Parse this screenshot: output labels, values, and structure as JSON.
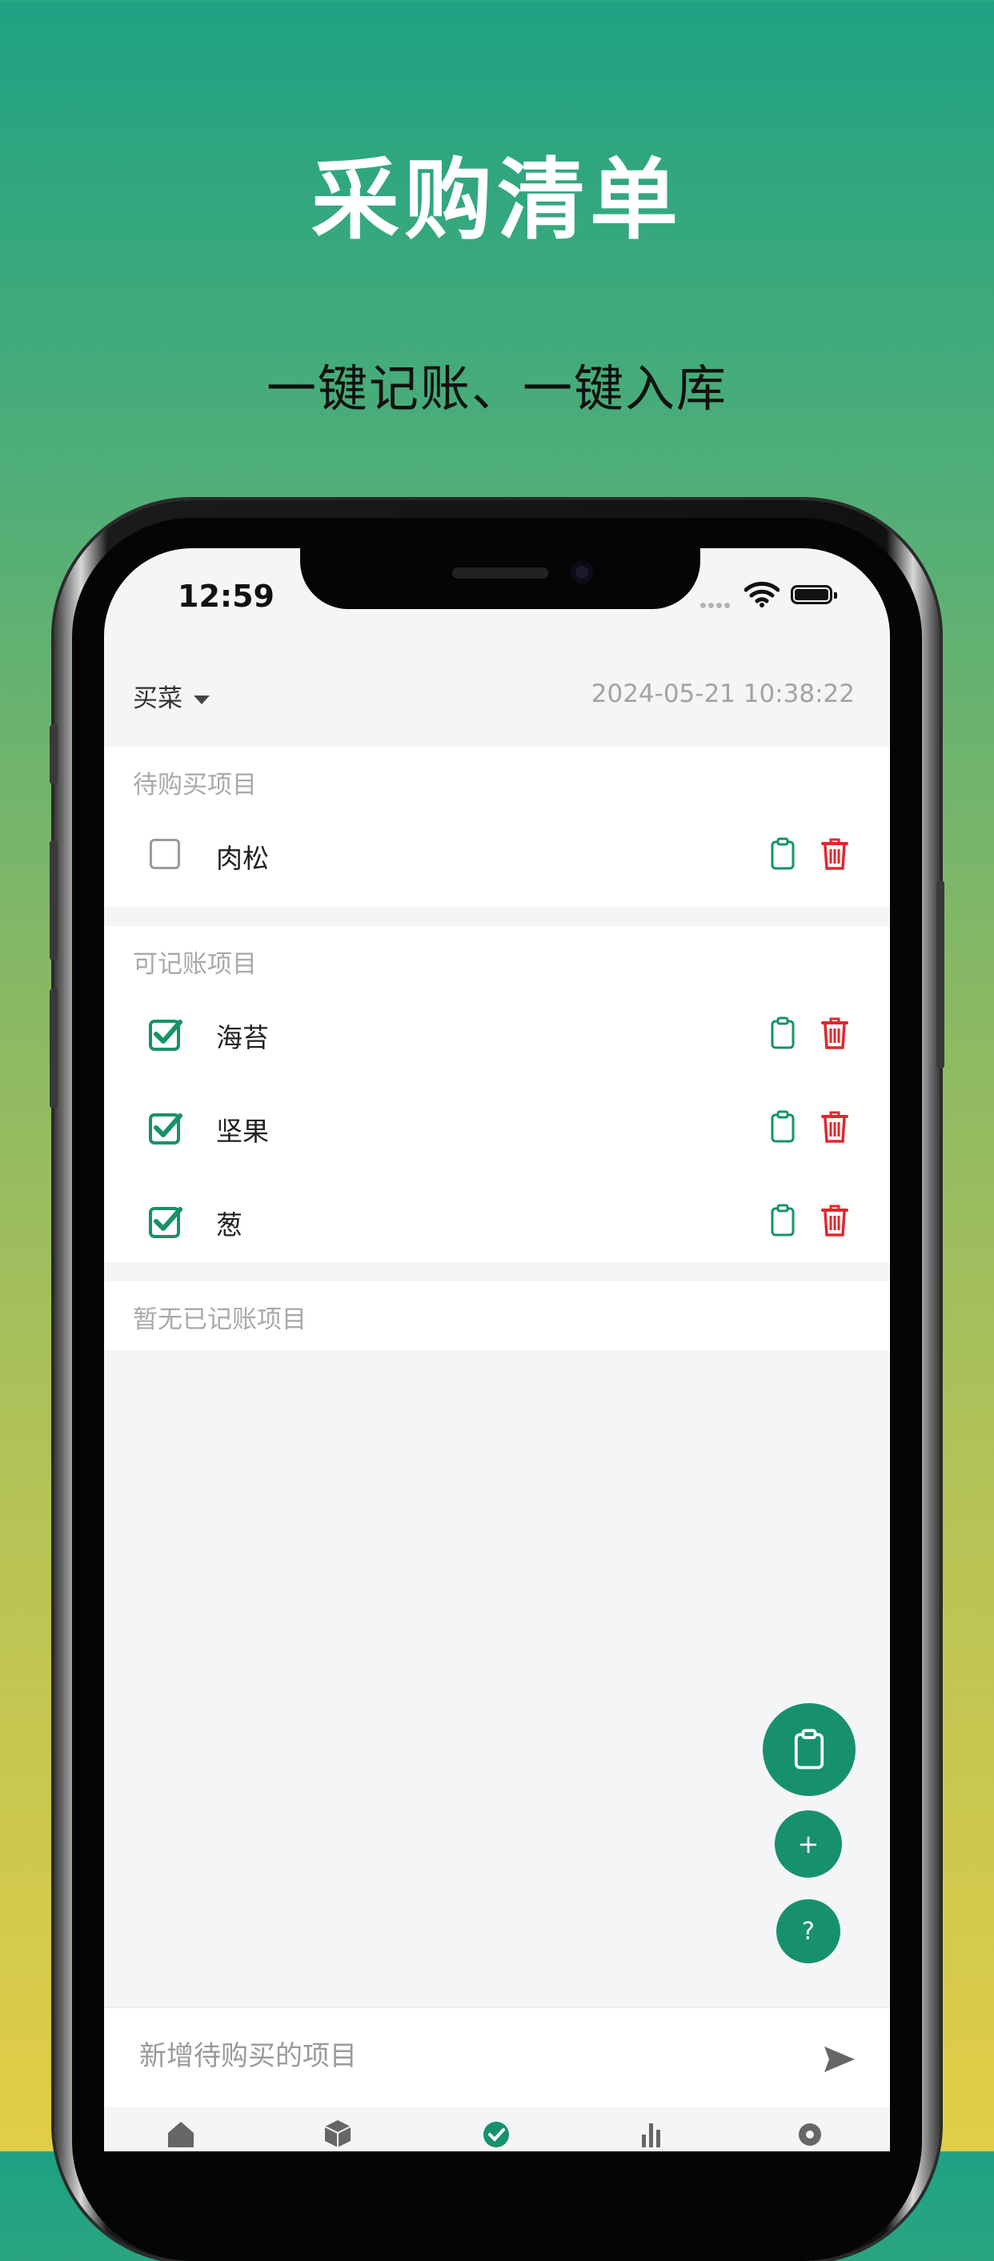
{
  "promo": {
    "title": "采购清单",
    "subtitle": "一键记账、一键入库"
  },
  "status_bar": {
    "time": "12:59"
  },
  "header": {
    "category": "买菜",
    "datetime": "2024-05-21 10:38:22"
  },
  "pending": {
    "title": "待购买项目",
    "items": [
      {
        "label": "肉松",
        "checked": false
      }
    ]
  },
  "billable": {
    "title": "可记账项目",
    "items": [
      {
        "label": "海苔",
        "checked": true
      },
      {
        "label": "坚果",
        "checked": true
      },
      {
        "label": "葱",
        "checked": true
      }
    ]
  },
  "recorded": {
    "title": "暂无已记账项目"
  },
  "fabs": {
    "add_symbol": "+",
    "help_symbol": "?"
  },
  "input": {
    "placeholder": "新增待购买的项目"
  },
  "tabs": [
    {
      "icon": "home-icon"
    },
    {
      "icon": "box-icon"
    },
    {
      "icon": "check-circle-icon"
    },
    {
      "icon": "bar-chart-icon"
    },
    {
      "icon": "gear-icon"
    }
  ],
  "colors": {
    "accent": "#17916c",
    "delete": "#e0282e",
    "gradient_top": "#1ea283",
    "gradient_bottom": "#e3cd46"
  }
}
